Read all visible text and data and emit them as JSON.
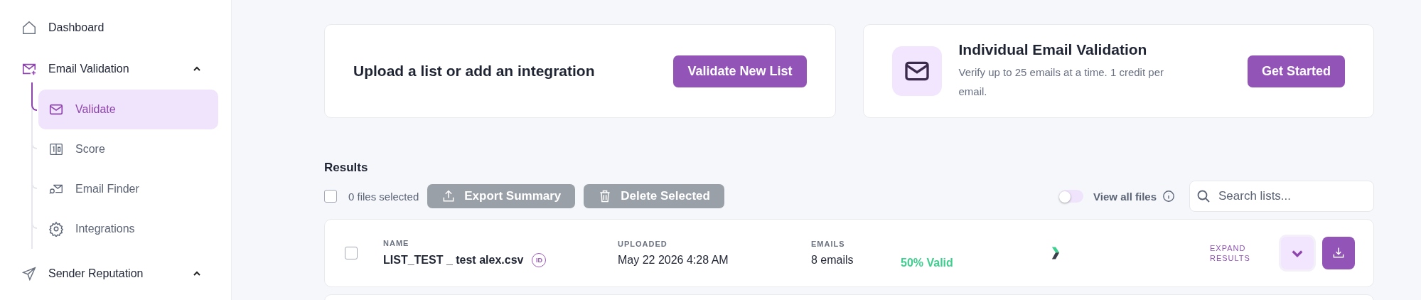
{
  "sidebar": {
    "items": [
      {
        "label": "Dashboard",
        "kind": "home",
        "selected": false
      },
      {
        "label": "Email Validation",
        "kind": "mail-plus",
        "expanded": true,
        "selected": true,
        "children": [
          {
            "label": "Validate",
            "kind": "mail",
            "selected": true
          },
          {
            "label": "Score",
            "kind": "score",
            "selected": false
          },
          {
            "label": "Email Finder",
            "kind": "finder",
            "selected": false
          },
          {
            "label": "Integrations",
            "kind": "gear",
            "selected": false
          }
        ]
      },
      {
        "label": "Sender Reputation",
        "kind": "send",
        "expanded": true,
        "selected": false
      }
    ]
  },
  "upload_card": {
    "text": "Upload a list or add an integration",
    "button": "Validate New List"
  },
  "individual_card": {
    "title": "Individual Email Validation",
    "description": "Verify up to 25 emails at a time. 1 credit per email.",
    "button": "Get Started"
  },
  "results": {
    "title": "Results",
    "select_all": {
      "checked": false,
      "label": "0 files selected"
    },
    "actions": [
      {
        "label": "Export Summary",
        "kind": "export",
        "disabled": true
      },
      {
        "label": "Delete Selected",
        "kind": "delete",
        "disabled": true
      }
    ],
    "view_all": {
      "label": "View all files",
      "on": false
    },
    "search": {
      "placeholder": "Search lists..."
    },
    "rows": [
      {
        "checked": false,
        "name_label": "NAME",
        "name": "LIST_TEST _ test alex.csv",
        "id_badge": "ID",
        "uploaded_label": "UPLOADED",
        "uploaded": "May 22 2026 4:28 AM",
        "emails_label": "EMAILS",
        "emails": "8 emails",
        "valid": "50% Valid",
        "expand": "EXPAND RESULTS"
      }
    ]
  }
}
